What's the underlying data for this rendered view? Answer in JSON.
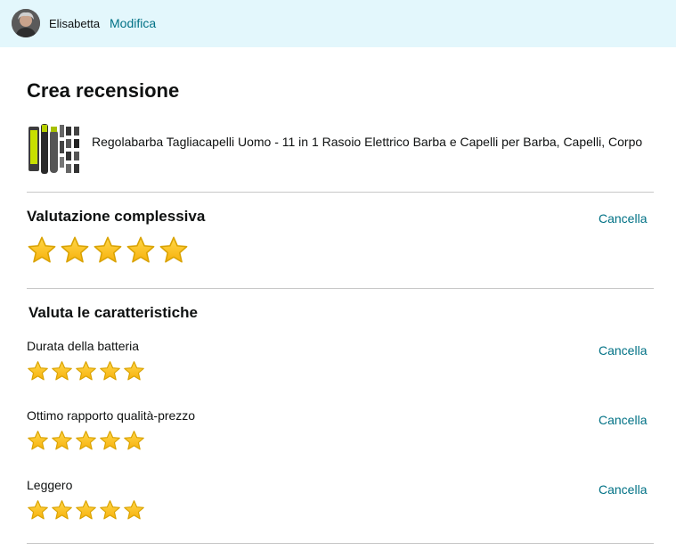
{
  "header": {
    "username": "Elisabetta",
    "edit_label": "Modifica",
    "background": "#e3f7fc",
    "link_color": "#007185"
  },
  "page": {
    "title": "Crea recensione"
  },
  "product": {
    "title": "Regolabarba Tagliacapelli Uomo - 11 in 1 Rasoio Elettrico Barba e Capelli per Barba, Capelli, Corpo"
  },
  "overall": {
    "heading": "Valutazione complessiva",
    "cancel_label": "Cancella",
    "rating": 5,
    "max": 5
  },
  "features": {
    "heading": "Valuta le caratteristiche",
    "items": [
      {
        "label": "Durata della batteria",
        "cancel_label": "Cancella",
        "rating": 5,
        "max": 5
      },
      {
        "label": "Ottimo rapporto qualità-prezzo",
        "cancel_label": "Cancella",
        "rating": 5,
        "max": 5
      },
      {
        "label": "Leggero",
        "cancel_label": "Cancella",
        "rating": 5,
        "max": 5
      }
    ]
  },
  "icons": {
    "star": "star-icon",
    "avatar": "avatar"
  },
  "colors": {
    "star_fill": "#ffc929",
    "star_stroke": "#d9a200",
    "divider": "#c7c7c7"
  }
}
